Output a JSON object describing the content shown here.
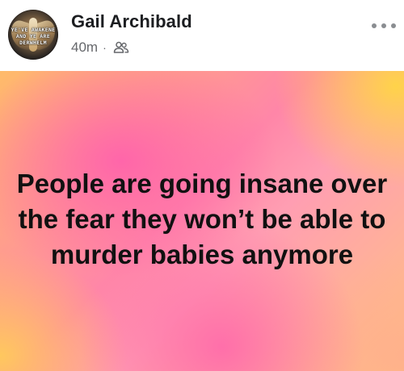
{
  "post": {
    "author": "Gail Archibald",
    "time": "40m",
    "separator": "·",
    "audience_icon": "friends-icon",
    "more_icon": "more-options-icon",
    "avatar_text": "YE'VE AWAKENE\nAND YE ARE\nDERWHELM",
    "card_lines": [
      "People are going insane over",
      "the fear they won’t be able to",
      "murder babies anymore"
    ],
    "colors": {
      "author": "#1c1e21",
      "meta": "#65676b",
      "background_pink": "#ff86a8",
      "background_yellow": "#ffd644",
      "background_orange": "#ffbb6a",
      "text": "#111111"
    }
  }
}
